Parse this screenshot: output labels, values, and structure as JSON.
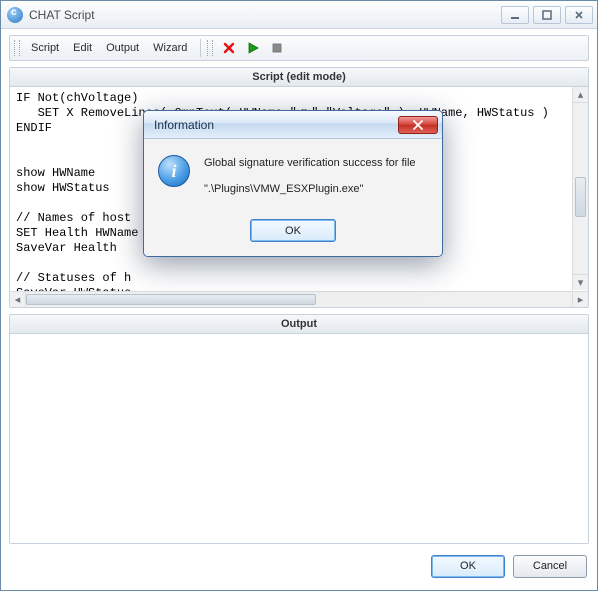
{
  "window": {
    "title": "CHAT Script"
  },
  "menu": {
    "script": "Script",
    "edit": "Edit",
    "output": "Output",
    "wizard": "Wizard"
  },
  "panels": {
    "script_header": "Script (edit mode)",
    "output_header": "Output"
  },
  "script_code": "IF Not(chVoltage)\n   SET X RemoveLines( CmpText( HWName,\"<>\",\"Voltage\" ), HWName, HWStatus )\nENDIF\n\n\nshow HWName\nshow HWStatus\n\n// Names of host\nSET Health HWName\nSaveVar Health\n\n// Statuses of h\nSaveVar HWStatus",
  "buttons": {
    "ok": "OK",
    "cancel": "Cancel"
  },
  "dialog": {
    "title": "Information",
    "line1": "Global signature verification success for file",
    "line2": "\".\\Plugins\\VMW_ESXPlugin.exe\"",
    "ok": "OK"
  }
}
